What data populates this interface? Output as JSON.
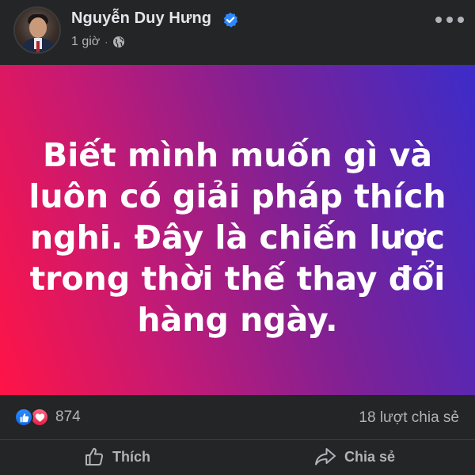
{
  "author": {
    "name": "Nguyễn Duy Hưng",
    "verified": true,
    "time": "1 giờ",
    "separator": "·",
    "audience_icon": "globe-icon"
  },
  "post": {
    "text": "Biết mình muốn gì và luôn có giải pháp thích nghi. Đây là chiến lược trong thời thế thay đổi hàng ngày.",
    "background_colors": [
      "#ff1446",
      "#7d2196",
      "#3c2cc9"
    ]
  },
  "stats": {
    "reaction_icons": [
      "like-icon",
      "love-icon"
    ],
    "reaction_count": "874",
    "shares": "18 lượt chia sẻ"
  },
  "actions": {
    "like_label": "Thích",
    "share_label": "Chia sẻ"
  }
}
